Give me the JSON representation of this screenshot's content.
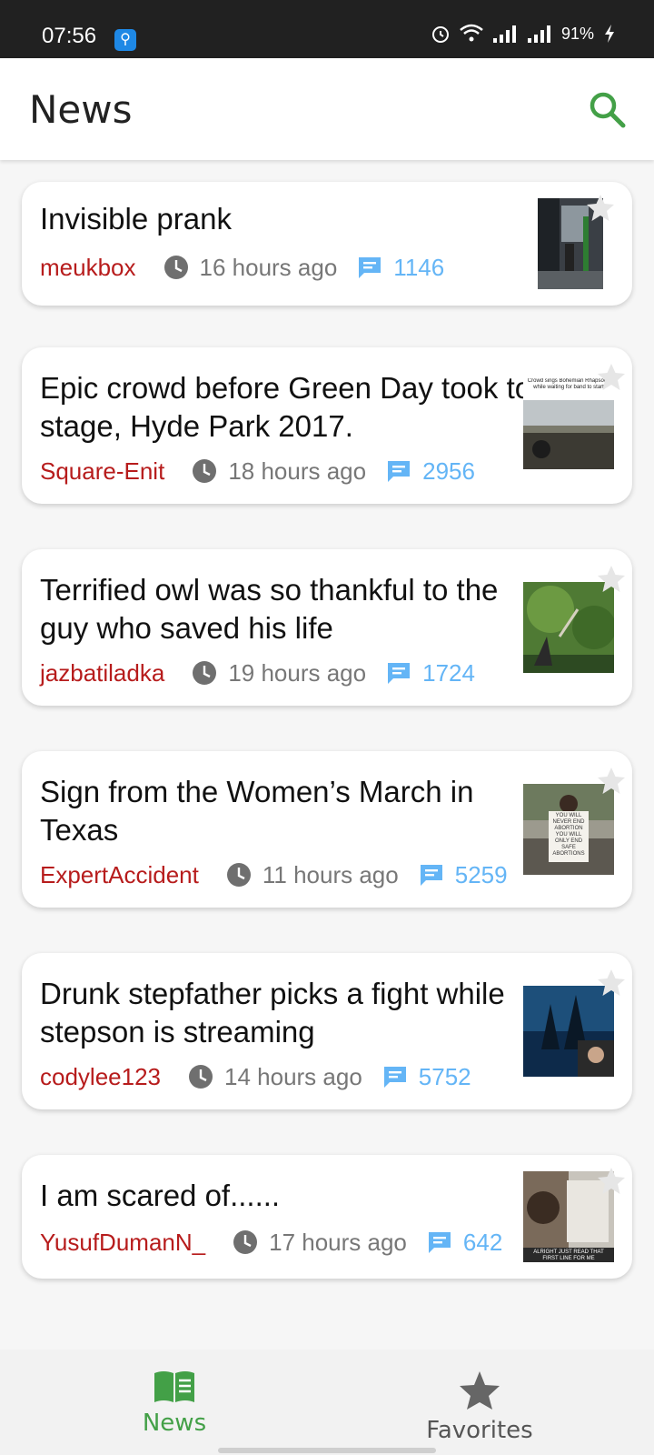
{
  "status_bar": {
    "time": "07:56",
    "battery": "91%"
  },
  "app_bar": {
    "title": "News",
    "search_icon": "search-icon"
  },
  "colors": {
    "accent": "#43a047",
    "author": "#b71c1c",
    "comments": "#64b5f6",
    "meta": "#777777"
  },
  "posts": [
    {
      "title_lines": [
        "Invisible prank"
      ],
      "author": "meukbox",
      "time": "16 hours ago",
      "comments": "1146"
    },
    {
      "title_lines": [
        "Epic crowd before Green Day took to",
        "stage, Hyde Park 2017."
      ],
      "author": "Square-Enit",
      "time": "18 hours ago",
      "comments": "2956"
    },
    {
      "title_lines": [
        "Terrified owl was so thankful to the",
        "guy who saved his life"
      ],
      "author": "jazbatiladka",
      "time": "19 hours ago",
      "comments": "1724"
    },
    {
      "title_lines": [
        "Sign from the Women’s March in",
        "Texas"
      ],
      "author": "ExpertAccident",
      "time": "11 hours ago",
      "comments": "5259"
    },
    {
      "title_lines": [
        "Drunk stepfather picks a fight while",
        "stepson is streaming"
      ],
      "author": "codylee123",
      "time": "14 hours ago",
      "comments": "5752"
    },
    {
      "title_lines": [
        "I am scared of......"
      ],
      "author": "YusufDumanN_",
      "time": "17 hours ago",
      "comments": "642"
    }
  ],
  "thumb_text": {
    "post2": "Crowd sings Bohemian Rhapsody while waiting for band to start",
    "post4": "YOU WILL NEVER END ABORTION YOU WILL ONLY END SAFE ABORTIONS",
    "post6": "ALRIGHT JUST READ THAT FIRST LINE FOR ME"
  },
  "bottom_nav": {
    "news": "News",
    "favorites": "Favorites"
  }
}
